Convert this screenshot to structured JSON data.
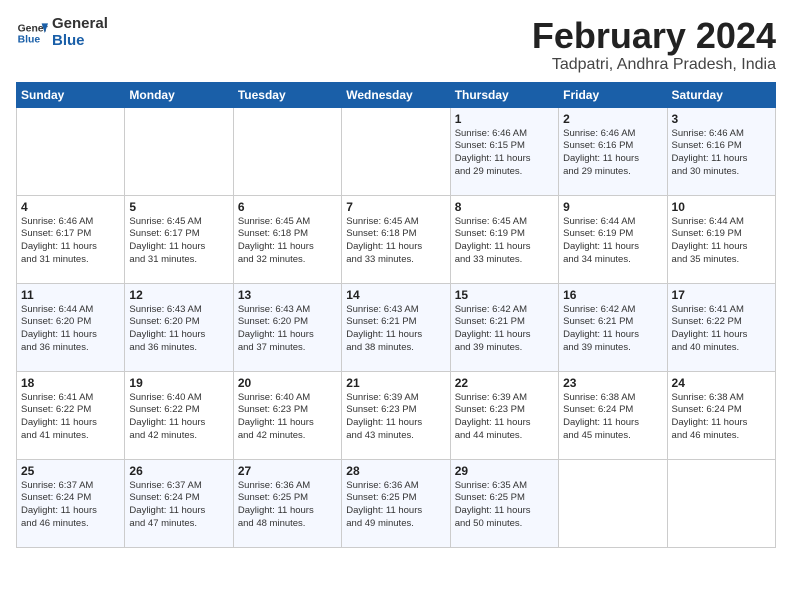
{
  "logo": {
    "line1": "General",
    "line2": "Blue"
  },
  "title": "February 2024",
  "subtitle": "Tadpatri, Andhra Pradesh, India",
  "header": {
    "days": [
      "Sunday",
      "Monday",
      "Tuesday",
      "Wednesday",
      "Thursday",
      "Friday",
      "Saturday"
    ]
  },
  "weeks": [
    [
      {
        "num": "",
        "info": ""
      },
      {
        "num": "",
        "info": ""
      },
      {
        "num": "",
        "info": ""
      },
      {
        "num": "",
        "info": ""
      },
      {
        "num": "1",
        "info": "Sunrise: 6:46 AM\nSunset: 6:15 PM\nDaylight: 11 hours\nand 29 minutes."
      },
      {
        "num": "2",
        "info": "Sunrise: 6:46 AM\nSunset: 6:16 PM\nDaylight: 11 hours\nand 29 minutes."
      },
      {
        "num": "3",
        "info": "Sunrise: 6:46 AM\nSunset: 6:16 PM\nDaylight: 11 hours\nand 30 minutes."
      }
    ],
    [
      {
        "num": "4",
        "info": "Sunrise: 6:46 AM\nSunset: 6:17 PM\nDaylight: 11 hours\nand 31 minutes."
      },
      {
        "num": "5",
        "info": "Sunrise: 6:45 AM\nSunset: 6:17 PM\nDaylight: 11 hours\nand 31 minutes."
      },
      {
        "num": "6",
        "info": "Sunrise: 6:45 AM\nSunset: 6:18 PM\nDaylight: 11 hours\nand 32 minutes."
      },
      {
        "num": "7",
        "info": "Sunrise: 6:45 AM\nSunset: 6:18 PM\nDaylight: 11 hours\nand 33 minutes."
      },
      {
        "num": "8",
        "info": "Sunrise: 6:45 AM\nSunset: 6:19 PM\nDaylight: 11 hours\nand 33 minutes."
      },
      {
        "num": "9",
        "info": "Sunrise: 6:44 AM\nSunset: 6:19 PM\nDaylight: 11 hours\nand 34 minutes."
      },
      {
        "num": "10",
        "info": "Sunrise: 6:44 AM\nSunset: 6:19 PM\nDaylight: 11 hours\nand 35 minutes."
      }
    ],
    [
      {
        "num": "11",
        "info": "Sunrise: 6:44 AM\nSunset: 6:20 PM\nDaylight: 11 hours\nand 36 minutes."
      },
      {
        "num": "12",
        "info": "Sunrise: 6:43 AM\nSunset: 6:20 PM\nDaylight: 11 hours\nand 36 minutes."
      },
      {
        "num": "13",
        "info": "Sunrise: 6:43 AM\nSunset: 6:20 PM\nDaylight: 11 hours\nand 37 minutes."
      },
      {
        "num": "14",
        "info": "Sunrise: 6:43 AM\nSunset: 6:21 PM\nDaylight: 11 hours\nand 38 minutes."
      },
      {
        "num": "15",
        "info": "Sunrise: 6:42 AM\nSunset: 6:21 PM\nDaylight: 11 hours\nand 39 minutes."
      },
      {
        "num": "16",
        "info": "Sunrise: 6:42 AM\nSunset: 6:21 PM\nDaylight: 11 hours\nand 39 minutes."
      },
      {
        "num": "17",
        "info": "Sunrise: 6:41 AM\nSunset: 6:22 PM\nDaylight: 11 hours\nand 40 minutes."
      }
    ],
    [
      {
        "num": "18",
        "info": "Sunrise: 6:41 AM\nSunset: 6:22 PM\nDaylight: 11 hours\nand 41 minutes."
      },
      {
        "num": "19",
        "info": "Sunrise: 6:40 AM\nSunset: 6:22 PM\nDaylight: 11 hours\nand 42 minutes."
      },
      {
        "num": "20",
        "info": "Sunrise: 6:40 AM\nSunset: 6:23 PM\nDaylight: 11 hours\nand 42 minutes."
      },
      {
        "num": "21",
        "info": "Sunrise: 6:39 AM\nSunset: 6:23 PM\nDaylight: 11 hours\nand 43 minutes."
      },
      {
        "num": "22",
        "info": "Sunrise: 6:39 AM\nSunset: 6:23 PM\nDaylight: 11 hours\nand 44 minutes."
      },
      {
        "num": "23",
        "info": "Sunrise: 6:38 AM\nSunset: 6:24 PM\nDaylight: 11 hours\nand 45 minutes."
      },
      {
        "num": "24",
        "info": "Sunrise: 6:38 AM\nSunset: 6:24 PM\nDaylight: 11 hours\nand 46 minutes."
      }
    ],
    [
      {
        "num": "25",
        "info": "Sunrise: 6:37 AM\nSunset: 6:24 PM\nDaylight: 11 hours\nand 46 minutes."
      },
      {
        "num": "26",
        "info": "Sunrise: 6:37 AM\nSunset: 6:24 PM\nDaylight: 11 hours\nand 47 minutes."
      },
      {
        "num": "27",
        "info": "Sunrise: 6:36 AM\nSunset: 6:25 PM\nDaylight: 11 hours\nand 48 minutes."
      },
      {
        "num": "28",
        "info": "Sunrise: 6:36 AM\nSunset: 6:25 PM\nDaylight: 11 hours\nand 49 minutes."
      },
      {
        "num": "29",
        "info": "Sunrise: 6:35 AM\nSunset: 6:25 PM\nDaylight: 11 hours\nand 50 minutes."
      },
      {
        "num": "",
        "info": ""
      },
      {
        "num": "",
        "info": ""
      }
    ]
  ]
}
